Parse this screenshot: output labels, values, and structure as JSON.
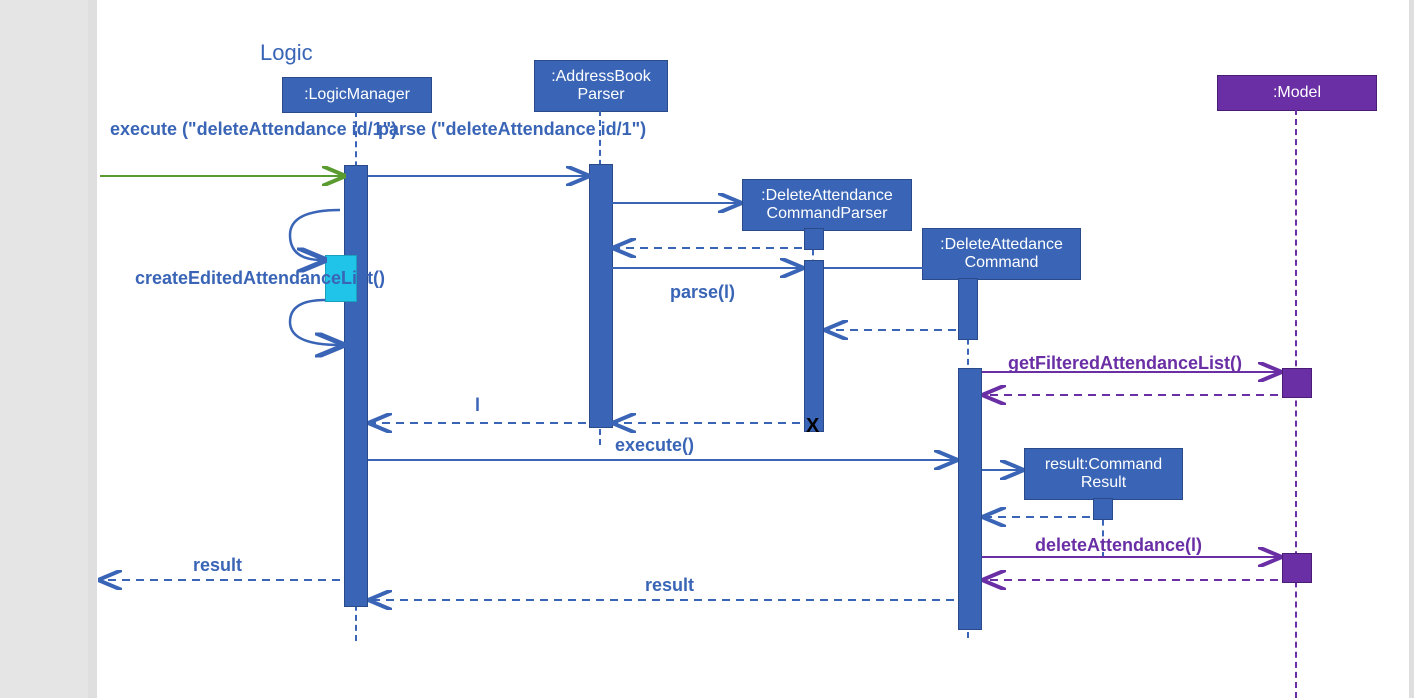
{
  "title": "Logic",
  "lifelines": {
    "logicManager": ":LogicManager",
    "addressBookParser": ":AddressBook Parser",
    "deleteAttendanceCommandParser": ":DeleteAttendance CommandParser",
    "deleteAttendanceCommand": ":DeleteAttedance Command",
    "commandResult": "result:Command Result",
    "model": ":Model"
  },
  "messages": {
    "executeIn": "execute (\"deleteAttendance id/1\")",
    "parseCmd": "parse (\"deleteAttendance id/1\")",
    "createEdited": "createEditedAttendanceList()",
    "parseL": "parse(l)",
    "returnL": "l",
    "destroyMark": "X",
    "execute": "execute()",
    "getFiltered": "getFilteredAttendanceList()",
    "deleteAttendance": "deleteAttendance(l)",
    "resultOut": "result",
    "resultBack": "result"
  }
}
